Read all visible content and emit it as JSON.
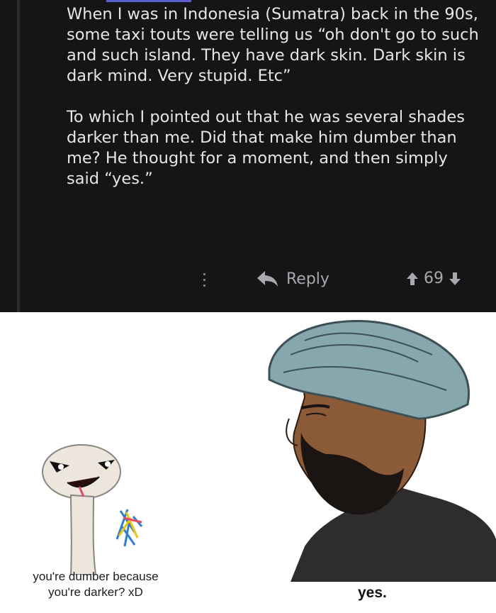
{
  "comment": {
    "paragraphs": [
      "When I was in Indonesia (Sumatra) back in the 90s, some taxi touts were telling us “oh don't go to such and such island. They have dark skin. Dark skin is dark mind. Very stupid. Etc”",
      "To which I pointed out that he was several shades darker than me. Did that make him dumber than me? He thought for a moment, and then simply said “yes.”"
    ],
    "actions": {
      "more_icon": "vertical-dots-icon",
      "reply_label": "Reply",
      "reply_icon": "reply-arrow-icon",
      "vote_count": "69",
      "upvote_icon": "arrow-up-icon",
      "downvote_icon": "arrow-down-icon"
    },
    "colors": {
      "background": "#151517",
      "text": "#e6e6e8",
      "meta_text": "#a8a8ad"
    }
  },
  "meme": {
    "left_caption": [
      "you're dumber because",
      "you're darker? xD"
    ],
    "right_caption": "yes.",
    "left_figure": "crying-soyjak-figure",
    "right_figure": "turbaned-bearded-chad-figure"
  }
}
